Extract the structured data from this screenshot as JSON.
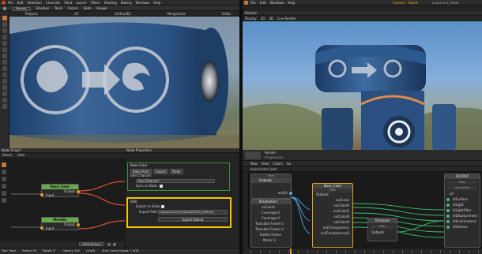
{
  "left_app": {
    "menus": [
      "File",
      "Edit",
      "Selection",
      "Channels",
      "Paint",
      "Layers",
      "Filters",
      "Shading",
      "Baking",
      "Windows",
      "Help"
    ],
    "toolbar": [
      "Brushes",
      "Tools",
      "Colors",
      "Slots",
      "Viewer"
    ],
    "mode": "Normal",
    "view_tabs": [
      "Projects",
      "UV",
      "Ortho(3D)",
      "Perspective",
      "Ortho"
    ],
    "node_graph": {
      "title": "Node Graph",
      "tabs": [
        "Select",
        "Host"
      ],
      "nodes": [
        {
          "title": "Base_Color",
          "port_in": "Input",
          "port_out": "Output"
        },
        {
          "title": "Metallic",
          "port_in": "Input",
          "port_out": "Output"
        }
      ],
      "zoom_field": "sRGB Default"
    },
    "node_properties": {
      "title": "Node Properties",
      "section1_title": "Base Color",
      "tabs": [
        "Bake Point",
        "Export",
        "Node"
      ],
      "gen_channel": "Gen Channel",
      "gen_channel_value": "Gen Channel",
      "sync_label": "Sync on Bake",
      "section2_title": "Disk",
      "export_on_bake": "Export on Bake",
      "export_path_label": "Export Path",
      "export_path_value": "/ws/pakamunt/tex/robot/$NODE_$UDIM.exr",
      "export_button": "Export Baked"
    },
    "status_bar": {
      "tool": "Tool: Paint",
      "radius": "Radius 90",
      "rotate": "Rotate 0°",
      "opacity": "Opacity 100",
      "grid": "GridDL",
      "cache": "Shdr Cache Usage: 1.6GB"
    }
  },
  "right_app": {
    "menus": [
      "File",
      "Edit",
      "Windows",
      "Help"
    ],
    "title": "Clarisse - Robot.",
    "project": "pakamunt_Robot",
    "monitor": {
      "title": "Monitor",
      "tabs": [
        "Display",
        "2D",
        "3D",
        "Live Render"
      ]
    },
    "node_editor": {
      "menus": [
        "New",
        "View",
        "Colors",
        "Go"
      ],
      "path": "build:/robot_bots",
      "nodes": [
        {
          "title": "Outputs",
          "filter": "Filter",
          "items": [
            "outUV"
          ]
        },
        {
          "title": "Parameters",
          "items": [
            "uvCoord",
            "Coverage U",
            "Coverage V",
            "Translate Frame U",
            "Translate Frame V",
            "Rotate Frame",
            "Mirror U"
          ]
        },
        {
          "title": "Base_Color",
          "filter": "Filter",
          "subtitle": "Outputs",
          "items": [
            "outColor",
            "outColorR",
            "outColorG",
            "outColorB",
            "outColorA",
            "outTransparency",
            "outTransparencyR"
          ]
        },
        {
          "title": "Emissive",
          "filter": "Filter",
          "subtitle": "Outputs"
        },
        {
          "title": "OUTPUT",
          "filter": "Filter",
          "subtitle": "Input Field",
          "items": [
            "all",
            "diSurface",
            "diLight",
            "diLightFilter",
            "diDisplacement",
            "diEnvironment",
            "diVolume"
          ]
        }
      ]
    },
    "render_panel": {
      "label": "Render",
      "sub": "Progressive"
    }
  },
  "colors": {
    "accent_orange": "#e0a020",
    "node_green": "#6aa84f",
    "node_orange": "#d9532f",
    "selection_yellow": "#f2c500",
    "wire_green": "#3cbf6b",
    "wire_blue": "#4ca6e8"
  }
}
